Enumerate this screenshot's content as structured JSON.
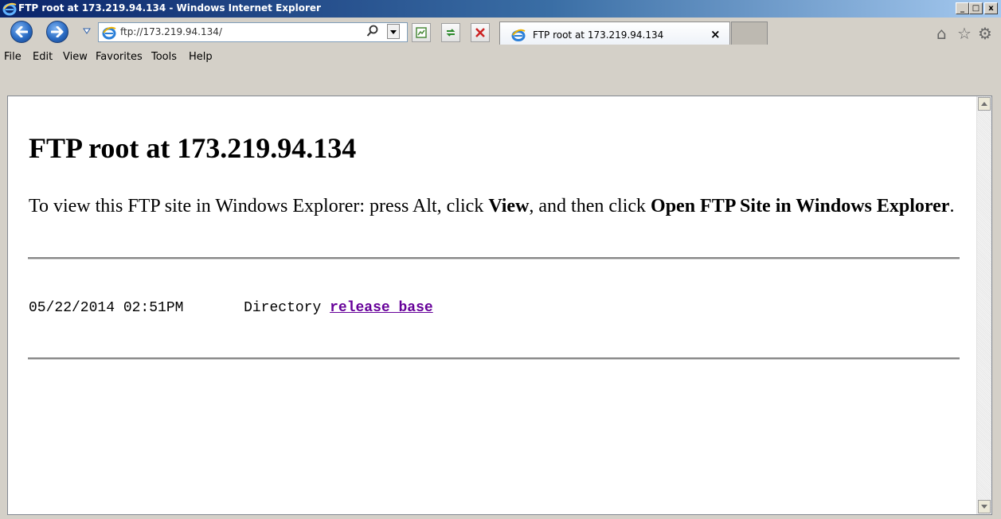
{
  "window": {
    "title": "FTP root at 173.219.94.134 - Windows Internet Explorer",
    "controls": {
      "minimize": "_",
      "maximize": "□",
      "close": "x"
    }
  },
  "navbar": {
    "address": "ftp://173.219.94.134/",
    "back_icon": "back-arrow-icon",
    "forward_icon": "forward-arrow-icon"
  },
  "tab": {
    "label": "FTP root at 173.219.94.134",
    "close": "×"
  },
  "menu": {
    "items": [
      "File",
      "Edit",
      "View",
      "Favorites",
      "Tools",
      "Help"
    ]
  },
  "page": {
    "heading": "FTP root at 173.219.94.134",
    "instructions_prefix": "To view this FTP site in Windows Explorer: press Alt, click ",
    "view_word": "View",
    "instructions_middle": ", and then click ",
    "open_ftp": "Open FTP Site in Windows Explorer",
    "instructions_end": ".",
    "listing": {
      "date": "05/22/2014 02:51PM",
      "type": "Directory",
      "name": "release_base"
    }
  },
  "colors": {
    "visited_link": "#660099",
    "titlebar_start": "#0a246a",
    "titlebar_end": "#a6caf0"
  }
}
